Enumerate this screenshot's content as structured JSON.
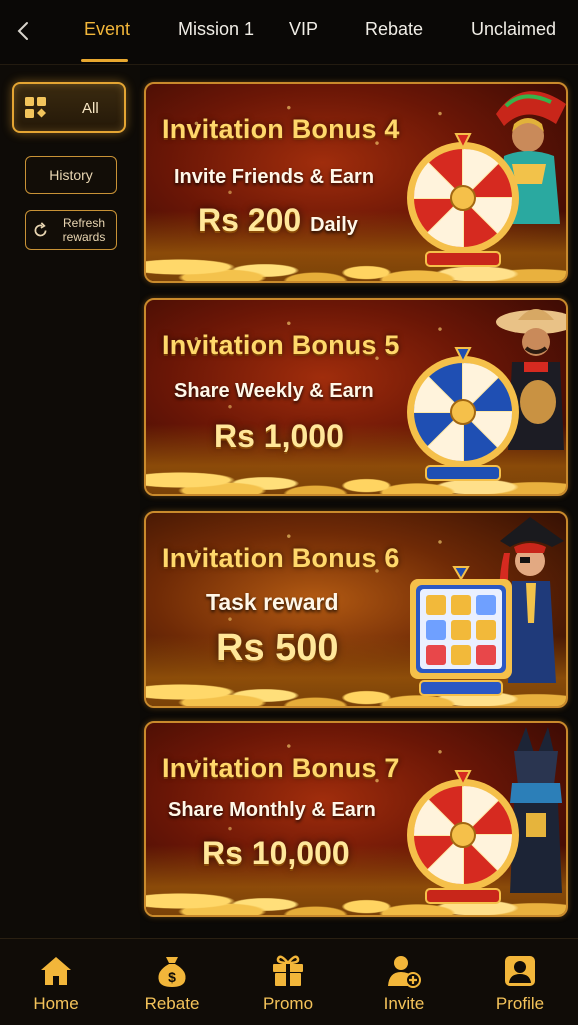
{
  "tabs": [
    {
      "label": "Event",
      "active": true
    },
    {
      "label": "Mission 1",
      "active": false
    },
    {
      "label": "VIP",
      "active": false
    },
    {
      "label": "Rebate",
      "active": false
    },
    {
      "label": "Unclaimed",
      "active": false
    }
  ],
  "sidebar": {
    "all_label": "All",
    "history_label": "History",
    "refresh_label": "Refresh rewards"
  },
  "banners": [
    {
      "title": "Invitation Bonus 4",
      "subtitle": "Invite Friends & Earn",
      "amount": "Rs 200",
      "suffix": "Daily"
    },
    {
      "title": "Invitation Bonus 5",
      "subtitle": "Share Weekly & Earn",
      "amount": "Rs 1,000",
      "suffix": ""
    },
    {
      "title": "Invitation Bonus 6",
      "subtitle": "Task reward",
      "amount": "Rs 500",
      "suffix": ""
    },
    {
      "title": "Invitation Bonus 7",
      "subtitle": "Share Monthly & Earn",
      "amount": "Rs 10,000",
      "suffix": ""
    }
  ],
  "bottom_nav": [
    {
      "label": "Home",
      "icon": "home-icon"
    },
    {
      "label": "Rebate",
      "icon": "money-bag-icon"
    },
    {
      "label": "Promo",
      "icon": "gift-icon"
    },
    {
      "label": "Invite",
      "icon": "add-user-icon"
    },
    {
      "label": "Profile",
      "icon": "profile-icon"
    }
  ],
  "colors": {
    "accent": "#f2b63a",
    "background": "#0b0906",
    "banner_border": "#c98a2c"
  }
}
